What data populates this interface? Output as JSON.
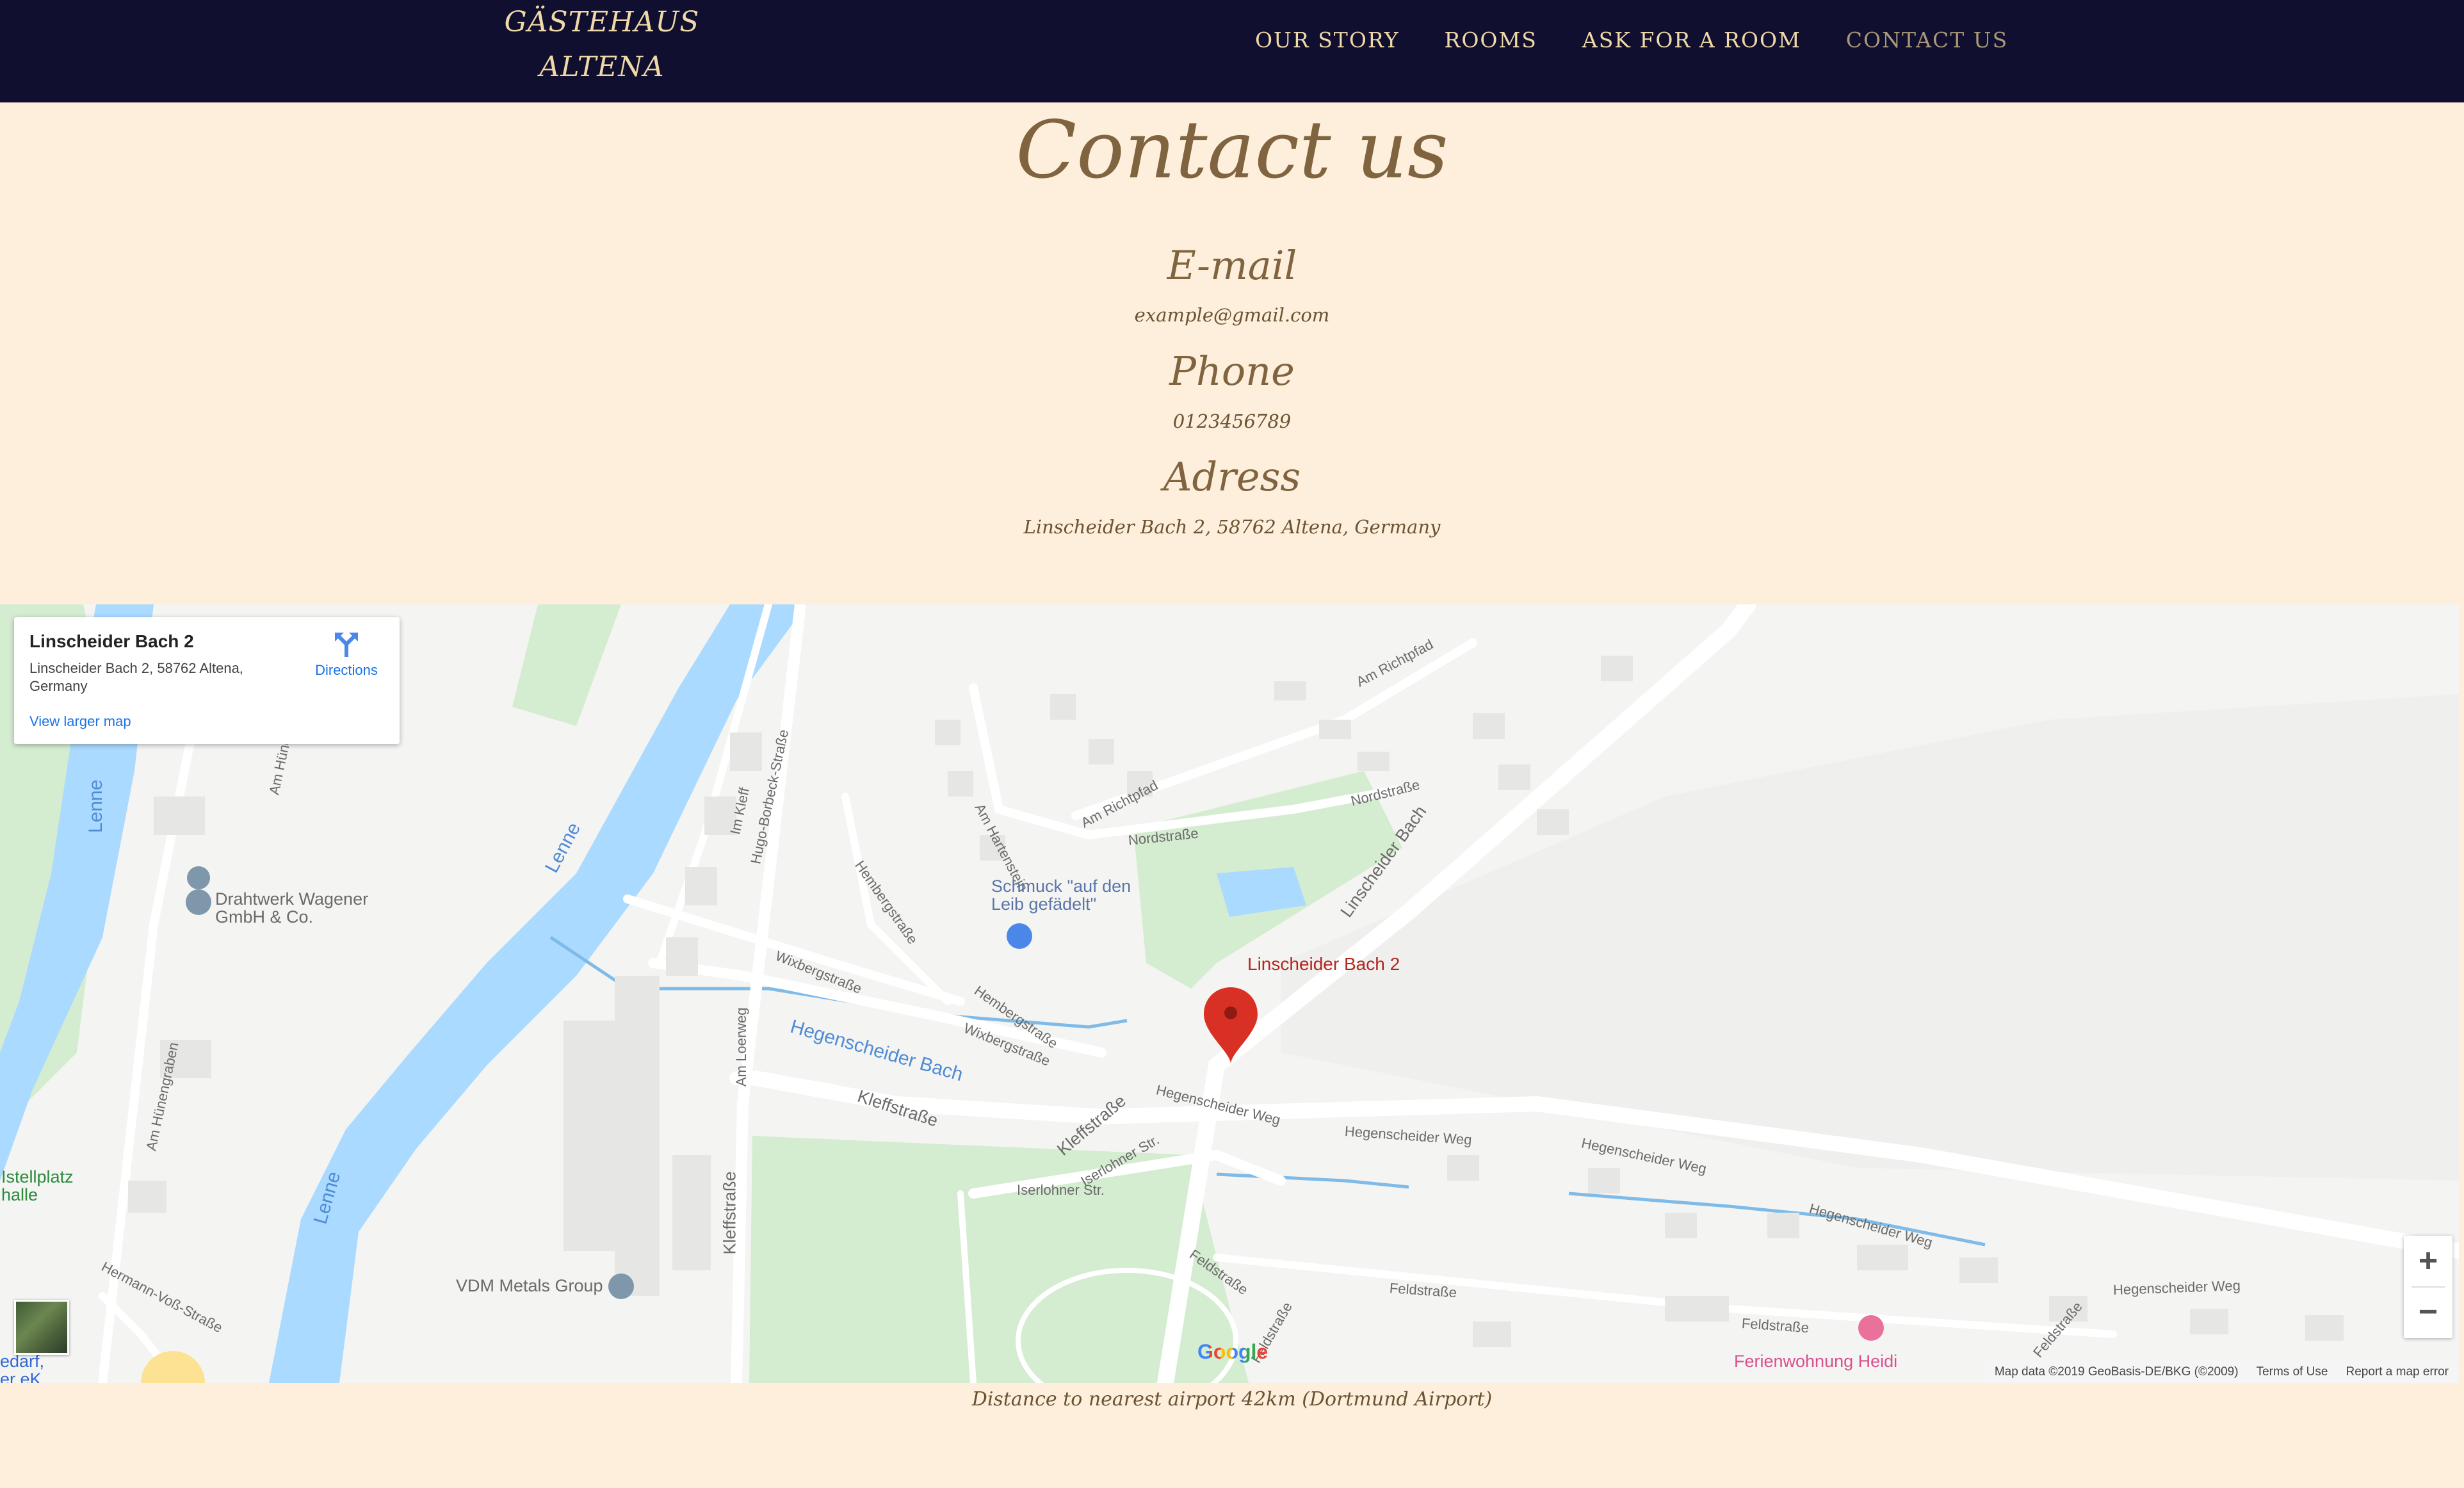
{
  "nav": {
    "brand_line1": "GÄSTEHAUS",
    "brand_line2": "ALTENA",
    "links": [
      "OUR STORY",
      "ROOMS",
      "ASK FOR A ROOM",
      "CONTACT US"
    ]
  },
  "contact": {
    "title": "Contact us",
    "email_heading": "E-mail",
    "email_value": "example@gmail.com",
    "phone_heading": "Phone",
    "phone_value": "0123456789",
    "address_heading": "Adress",
    "address_value": "Linscheider Bach 2, 58762 Altena, Germany"
  },
  "map": {
    "card": {
      "title": "Linscheider Bach 2",
      "address": "Linscheider Bach 2, 58762 Altena, Germany",
      "directions": "Directions",
      "larger_map": "View larger map"
    },
    "marker_label": "Linscheider Bach 2",
    "labels": {
      "lenne": "Lenne",
      "hegenscheider_bach": "Hegenscheider Bach",
      "kleffstrasse": "Kleffstraße",
      "linscheider_bach": "Linscheider Bach",
      "nordstrasse": "Nordstraße",
      "am_richtpfad": "Am Richtpfad",
      "am_hartenstein": "Am Hartenstein",
      "hembergstrasse": "Hembergstraße",
      "wixbergstrasse": "Wixbergstraße",
      "hugo_borbeck": "Hugo-Borbeck-Straße",
      "im_kleff": "Im Kleff",
      "am_loerweg": "Am Loerweg",
      "hegenscheider_weg": "Hegenscheider Weg",
      "iserlohner_str": "Iserlohner Str.",
      "feldstrasse": "Feldstraße",
      "am_huenengraben": "Am Hünengraben",
      "am_huene": "Am Hüne",
      "hermann_voss": "Hermann-Voß-Straße",
      "drahtwerk": "Drahtwerk Wagener GmbH & Co.",
      "schmuck": "Schmuck \"auf den Leib gefädelt\"",
      "vdm": "VDM Metals Group",
      "ferienwohnung": "Ferienwohnung Heidi",
      "stellplatz": "Istellplatz halle",
      "edarf": "edarf, er eK"
    },
    "zoom_in": "+",
    "zoom_out": "−",
    "google": "Google",
    "attribution": [
      "Map data ©2019 GeoBasis-DE/BKG (©2009)",
      "Terms of Use",
      "Report a map error"
    ]
  },
  "footer": {
    "distance": "Distance to nearest airport 42km (Dortmund Airport)"
  },
  "colors": {
    "navbar_bg": "#110f2f",
    "nav_text": "#efd9a8",
    "page_bg": "#fdefdc",
    "heading": "#806440",
    "marker": "#d93025",
    "water": "#aadaff"
  }
}
